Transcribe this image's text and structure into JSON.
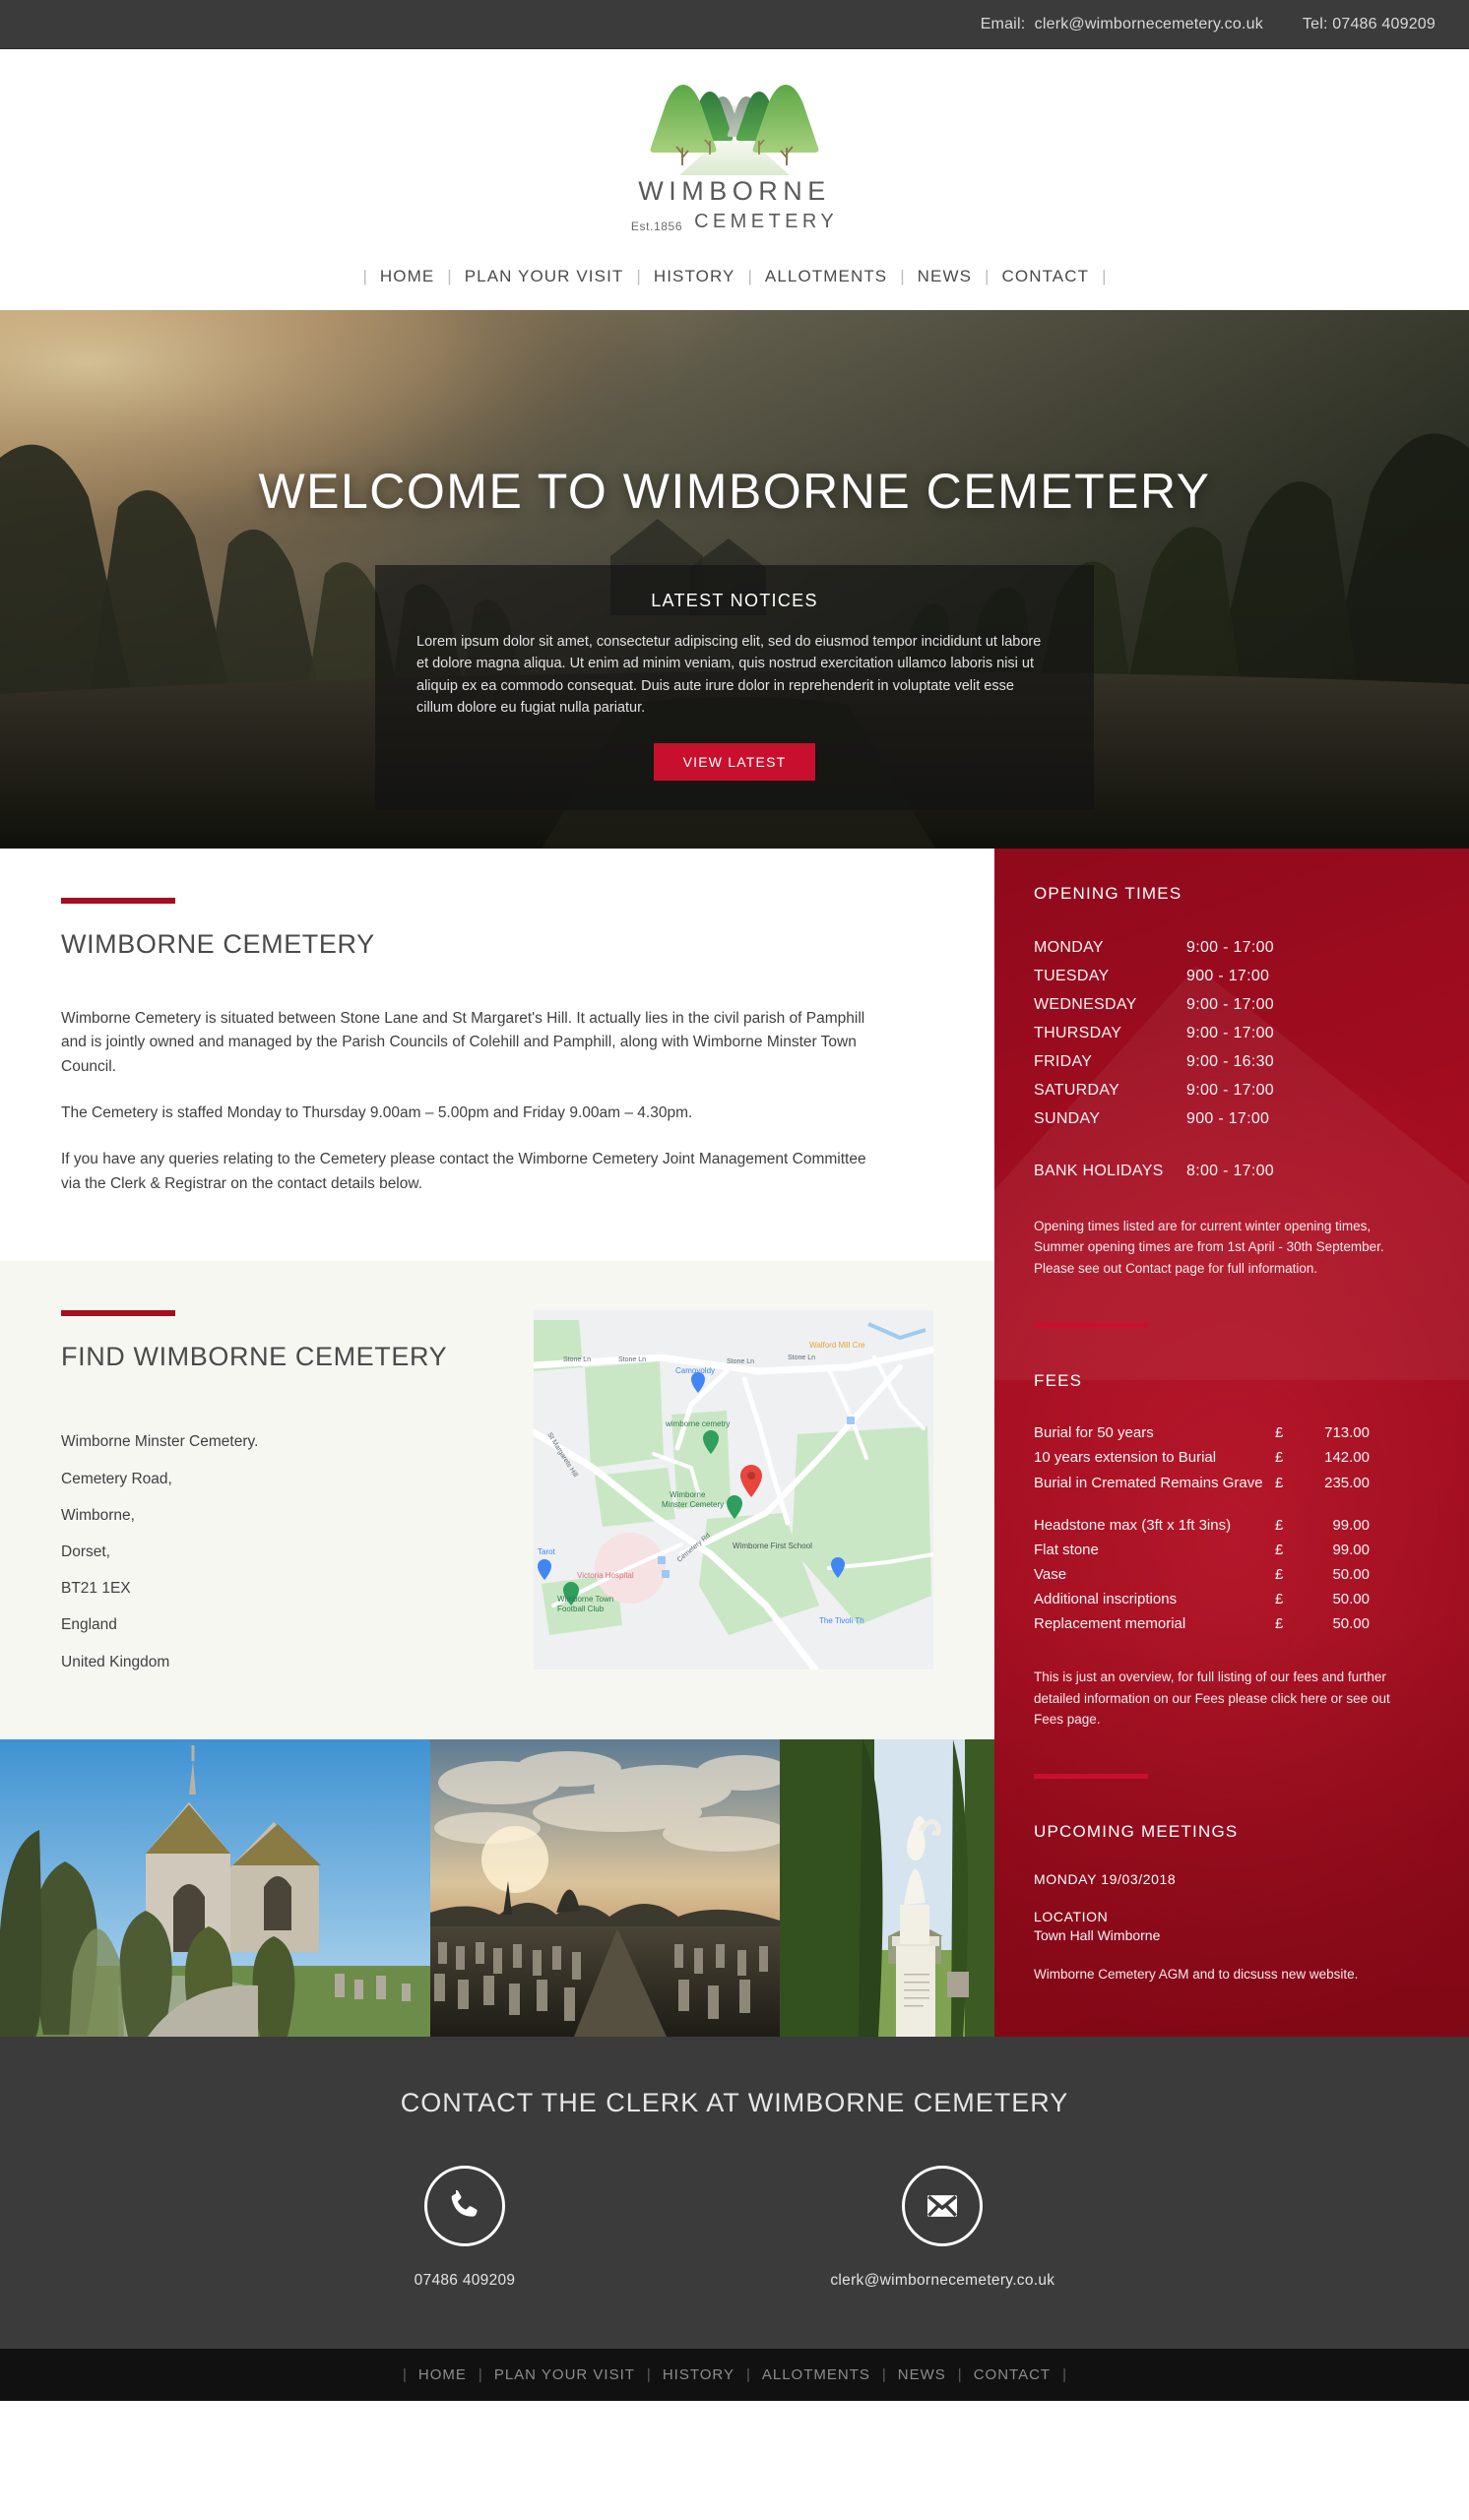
{
  "topbar": {
    "email_label": "Email:",
    "email": "clerk@wimbornecemetery.co.uk",
    "tel": "Tel: 07486 409209"
  },
  "logo": {
    "name": "WIMBORNE",
    "est": "Est.1856",
    "sub": "CEMETERY"
  },
  "nav": {
    "sep": "|",
    "items": [
      {
        "label": "HOME"
      },
      {
        "label": "PLAN YOUR VISIT"
      },
      {
        "label": "HISTORY"
      },
      {
        "label": "ALLOTMENTS"
      },
      {
        "label": "NEWS"
      },
      {
        "label": "CONTACT"
      }
    ]
  },
  "hero": {
    "title": "WELCOME TO WIMBORNE CEMETERY",
    "notices_title": "LATEST NOTICES",
    "notices_body": "Lorem ipsum dolor sit amet, consectetur adipiscing elit, sed do eiusmod tempor incididunt ut labore et dolore magna aliqua. Ut enim ad minim veniam, quis nostrud exercitation ullamco laboris nisi ut aliquip ex ea commodo consequat. Duis aute irure dolor in reprehenderit in voluptate velit esse cillum dolore eu fugiat nulla pariatur.",
    "button_label": "VIEW LATEST"
  },
  "intro": {
    "heading": "WIMBORNE CEMETERY",
    "p1": "Wimborne Cemetery is situated between Stone Lane and St Margaret's Hill. It actually lies in the civil parish of Pamphill and is jointly owned and managed by the Parish Councils of Colehill and Pamphill, along with Wimborne Minster Town Council.",
    "p2": "The Cemetery is staffed Monday to Thursday 9.00am – 5.00pm and Friday 9.00am – 4.30pm.",
    "p3": "If you have any queries relating to the Cemetery please contact the Wimborne Cemetery Joint Management Committee via the Clerk & Registrar on the contact details below."
  },
  "find": {
    "heading": "FIND WIMBORNE CEMETERY",
    "address": [
      "Wimborne Minster Cemetery.",
      "Cemetery Road,",
      "Wimborne,",
      "Dorset,",
      "BT21 1EX",
      "England",
      "United Kingdom"
    ],
    "map": {
      "pin_color": "#e8453c",
      "labels": [
        "Stone Ln",
        "Camoyoldy",
        "Wimborne cemetry",
        "Wimborne Minster Cemetery",
        "St Margarets Hill",
        "Victoria Hospital",
        "Wimborne Town Football Club",
        "Wimborne First School",
        "Tarot",
        "Walford Mill Cre",
        "The Tivoli Th",
        "Cemetery Rd"
      ]
    }
  },
  "gallery": {
    "images": [
      {
        "caption": "Cemetery chapel with yew trees"
      },
      {
        "caption": "Gravestones at sunset"
      },
      {
        "caption": "Angel memorial statue"
      }
    ]
  },
  "opening": {
    "title": "OPENING TIMES",
    "rows": [
      {
        "day": "MONDAY",
        "time": "9:00 - 17:00"
      },
      {
        "day": "TUESDAY",
        "time": "900 - 17:00"
      },
      {
        "day": "WEDNESDAY",
        "time": "9:00 - 17:00"
      },
      {
        "day": "THURSDAY",
        "time": "9:00 - 17:00"
      },
      {
        "day": "FRIDAY",
        "time": "9:00 - 16:30"
      },
      {
        "day": "SATURDAY",
        "time": "9:00 - 17:00"
      },
      {
        "day": "SUNDAY",
        "time": "900 - 17:00"
      }
    ],
    "bank": {
      "day": "BANK HOLIDAYS",
      "time": "8:00 - 17:00"
    },
    "note": "Opening times listed are for current winter opening times, Summer opening times are from 1st April - 30th September. Please see out Contact page for full information."
  },
  "fees": {
    "title": "FEES",
    "group1": [
      {
        "name": "Burial for 50 years",
        "currency": "£",
        "value": "713.00"
      },
      {
        "name": "10 years extension to Burial",
        "currency": "£",
        "value": "142.00"
      },
      {
        "name": "Burial in Cremated Remains Grave",
        "currency": "£",
        "value": "235.00"
      }
    ],
    "group2": [
      {
        "name": "Headstone max (3ft x 1ft 3ins)",
        "currency": "£",
        "value": "99.00"
      },
      {
        "name": "Flat stone",
        "currency": "£",
        "value": "99.00"
      },
      {
        "name": "Vase",
        "currency": "£",
        "value": "50.00"
      },
      {
        "name": "Additional inscriptions",
        "currency": "£",
        "value": "50.00"
      },
      {
        "name": "Replacement memorial",
        "currency": "£",
        "value": "50.00"
      }
    ],
    "note": "This is just an overview, for full listing of our fees and further detailed information on our Fees please click here or see out Fees page."
  },
  "meetings": {
    "title": "UPCOMING MEETINGS",
    "date": "MONDAY 19/03/2018",
    "location_label": "LOCATION",
    "location": "Town Hall Wimborne",
    "description": "Wimborne Cemetery AGM and to dicsuss new website."
  },
  "footer_contact": {
    "title": "CONTACT THE CLERK AT WIMBORNE CEMETERY",
    "phone_icon": "phone-icon",
    "phone": "07486 409209",
    "email_icon": "envelope-icon",
    "email": "clerk@wimbornecemetery.co.uk"
  },
  "footer_nav": {
    "sep": "|",
    "items": [
      {
        "label": "HOME"
      },
      {
        "label": "PLAN YOUR VISIT"
      },
      {
        "label": "HISTORY"
      },
      {
        "label": "ALLOTMENTS"
      },
      {
        "label": "NEWS"
      },
      {
        "label": "CONTACT"
      }
    ]
  },
  "colors": {
    "accent_red": "#a50d20",
    "button_red": "#c8102e",
    "dark_bar": "#3b3b3b",
    "footer_black": "#111111",
    "cream": "#f7f7f2"
  }
}
